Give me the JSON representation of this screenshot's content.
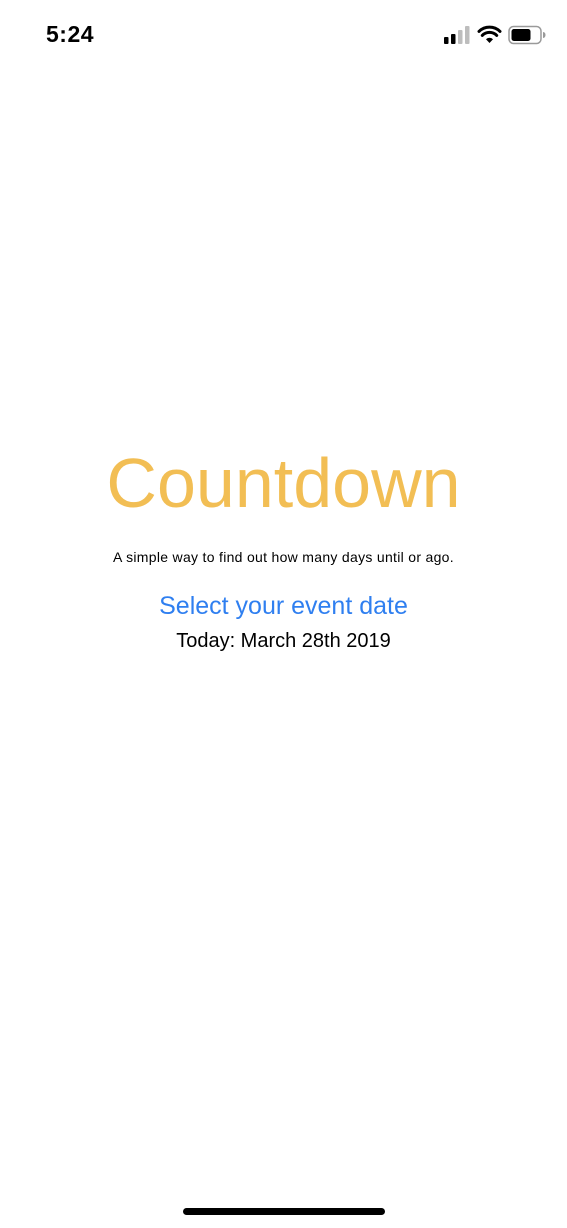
{
  "status_bar": {
    "time": "5:24"
  },
  "icons": {
    "signal": "cellular-signal-icon",
    "wifi": "wifi-icon",
    "battery": "battery-icon"
  },
  "main": {
    "title": "Countdown",
    "subtitle": "A simple way to find out how many days until or ago.",
    "select_date_label": "Select your event date",
    "today_label": "Today: March 28th 2019"
  },
  "colors": {
    "title": "#F2BE54",
    "link": "#2F7FF0",
    "text": "#000000",
    "background": "#FFFFFF"
  }
}
